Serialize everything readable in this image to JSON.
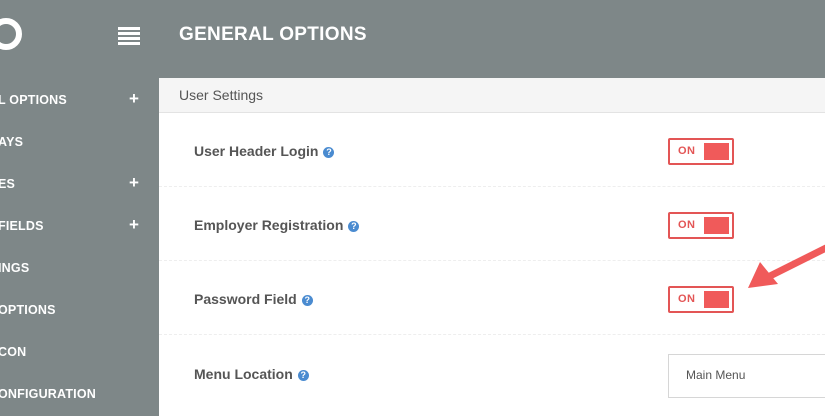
{
  "sidebar": {
    "items": [
      {
        "label": "L OPTIONS",
        "has_plus": true
      },
      {
        "label": "AYS",
        "has_plus": false
      },
      {
        "label": "ES",
        "has_plus": true
      },
      {
        "label": "  FIELDS",
        "has_plus": true
      },
      {
        "label": "INGS",
        "has_plus": false
      },
      {
        "label": "OPTIONS",
        "has_plus": false
      },
      {
        "label": "CON",
        "has_plus": false
      },
      {
        "label": "ONFIGURATION",
        "has_plus": false
      }
    ],
    "plus_symbol": "+"
  },
  "header": {
    "title": "GENERAL OPTIONS"
  },
  "section": {
    "title": "User Settings"
  },
  "settings": [
    {
      "label": "User Header Login",
      "help": "?",
      "toggle": "ON"
    },
    {
      "label": "Employer Registration",
      "help": "?",
      "toggle": "ON"
    },
    {
      "label": "Password Field",
      "help": "?",
      "toggle": "ON"
    },
    {
      "label": "Menu Location",
      "help": "?",
      "select_value": "Main Menu"
    }
  ],
  "colors": {
    "sidebar_bg": "#7e8788",
    "toggle_accent": "#e35555",
    "help_icon": "#4a8bd0",
    "arrow": "#f05a5a"
  },
  "icons": {
    "logo": "logo-icon",
    "menu": "hamburger-menu-icon",
    "help": "help-icon",
    "annotation": "annotation-arrow-icon"
  }
}
